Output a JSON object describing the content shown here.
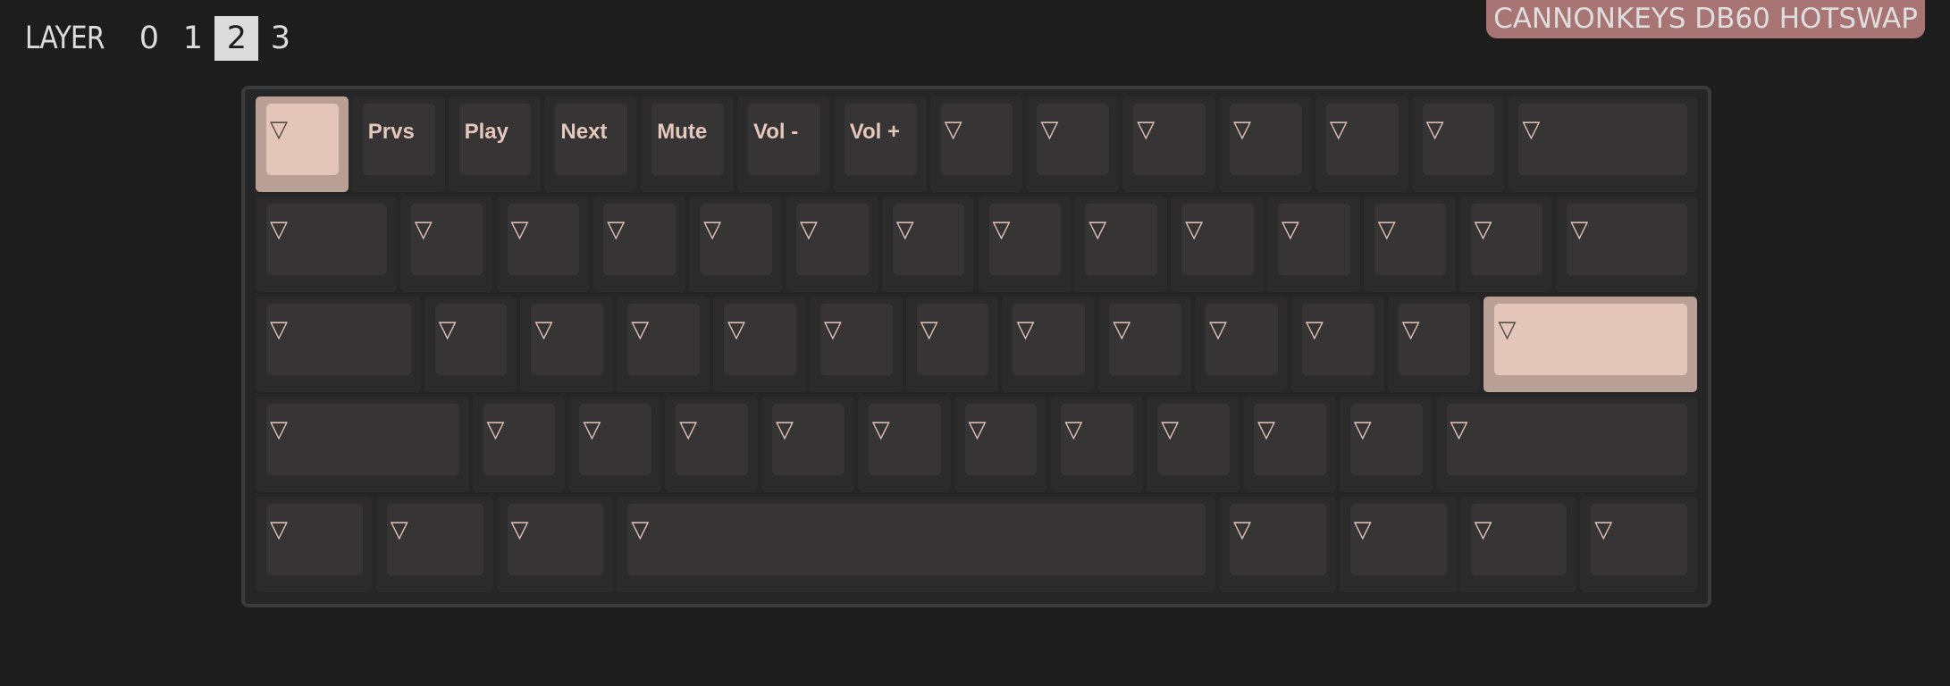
{
  "layer_selector": {
    "label": "LAYER",
    "layers": [
      "0",
      "1",
      "2",
      "3"
    ],
    "active": "2"
  },
  "keyboard_name": "CANNONKEYS DB60 HOTSWAP",
  "colors": {
    "background": "#1d1d1d",
    "badge": "#a87574",
    "legend": "#e5c7bb",
    "selected_cap": "#e3c5b9",
    "key_cap": "#363435"
  },
  "keys": [
    [
      {
        "legend": "▽",
        "selected": true
      },
      {
        "legend": "Prvs"
      },
      {
        "legend": "Play"
      },
      {
        "legend": "Next"
      },
      {
        "legend": "Mute"
      },
      {
        "legend": "Vol -"
      },
      {
        "legend": "Vol +"
      },
      {
        "legend": "▽"
      },
      {
        "legend": "▽"
      },
      {
        "legend": "▽"
      },
      {
        "legend": "▽"
      },
      {
        "legend": "▽"
      },
      {
        "legend": "▽"
      },
      {
        "legend": "▽"
      }
    ],
    [
      {
        "legend": "▽"
      },
      {
        "legend": "▽"
      },
      {
        "legend": "▽"
      },
      {
        "legend": "▽"
      },
      {
        "legend": "▽"
      },
      {
        "legend": "▽"
      },
      {
        "legend": "▽"
      },
      {
        "legend": "▽"
      },
      {
        "legend": "▽"
      },
      {
        "legend": "▽"
      },
      {
        "legend": "▽"
      },
      {
        "legend": "▽"
      },
      {
        "legend": "▽"
      },
      {
        "legend": "▽"
      }
    ],
    [
      {
        "legend": "▽"
      },
      {
        "legend": "▽"
      },
      {
        "legend": "▽"
      },
      {
        "legend": "▽"
      },
      {
        "legend": "▽"
      },
      {
        "legend": "▽"
      },
      {
        "legend": "▽"
      },
      {
        "legend": "▽"
      },
      {
        "legend": "▽"
      },
      {
        "legend": "▽"
      },
      {
        "legend": "▽"
      },
      {
        "legend": "▽"
      },
      {
        "legend": "▽",
        "selected": true
      }
    ],
    [
      {
        "legend": "▽"
      },
      {
        "legend": "▽"
      },
      {
        "legend": "▽"
      },
      {
        "legend": "▽"
      },
      {
        "legend": "▽"
      },
      {
        "legend": "▽"
      },
      {
        "legend": "▽"
      },
      {
        "legend": "▽"
      },
      {
        "legend": "▽"
      },
      {
        "legend": "▽"
      },
      {
        "legend": "▽"
      },
      {
        "legend": "▽"
      }
    ],
    [
      {
        "legend": "▽"
      },
      {
        "legend": "▽"
      },
      {
        "legend": "▽"
      },
      {
        "legend": "▽"
      },
      {
        "legend": "▽"
      },
      {
        "legend": "▽"
      },
      {
        "legend": "▽"
      },
      {
        "legend": "▽"
      }
    ]
  ]
}
